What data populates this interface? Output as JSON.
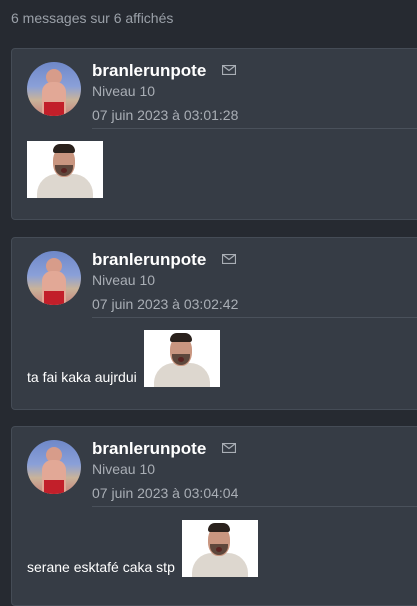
{
  "header": {
    "count_text": "6 messages sur 6 affichés"
  },
  "messages": [
    {
      "username": "branlerunpote",
      "level": "Niveau 10",
      "timestamp": "07 juin 2023 à 03:01:28",
      "text": ""
    },
    {
      "username": "branlerunpote",
      "level": "Niveau 10",
      "timestamp": "07 juin 2023 à 03:02:42",
      "text": "ta fai kaka aujrdui"
    },
    {
      "username": "branlerunpote",
      "level": "Niveau 10",
      "timestamp": "07 juin 2023 à 03:04:04",
      "text": "serane esktafé caka stp"
    }
  ],
  "icons": {
    "mail": "mail-icon"
  },
  "colors": {
    "background": "#262a31",
    "card": "#363c45",
    "text": "#ffffff",
    "muted": "#a9aeb5"
  }
}
